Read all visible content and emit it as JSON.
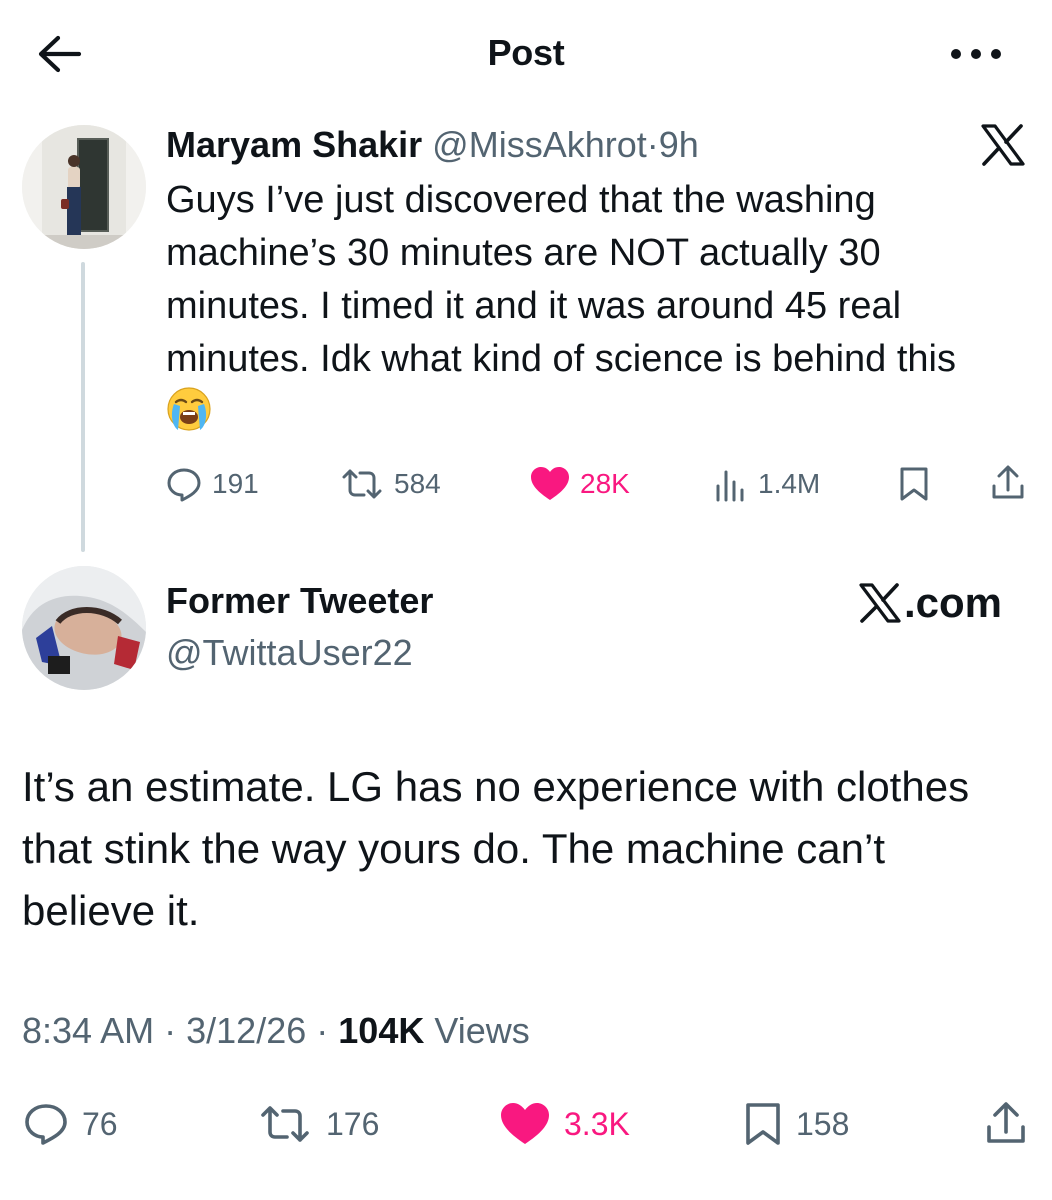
{
  "header": {
    "title": "Post"
  },
  "original_tweet": {
    "author_name": "Maryam Shakir",
    "handle": "@MissAkhrot",
    "separator": "·",
    "time": "9h",
    "text": "Guys I’ve just discovered that the washing machine’s 30 minutes are NOT actually 30 minutes. I timed it and it was around 45 real minutes. Idk what kind of science is behind this",
    "emoji": "loudly-crying-face",
    "replies": "191",
    "reposts": "584",
    "likes": "28K",
    "views": "1.4M",
    "liked": true,
    "source_logo": "x-logo-icon"
  },
  "reply_tweet": {
    "author_name": "Former Tweeter",
    "handle": "@TwittaUser22",
    "brand_text": ".com",
    "text": "It’s an estimate. LG has no experience with clothes that stink the way yours do. The machine can’t believe it.",
    "time": "8:34 AM",
    "separator": "·",
    "date": "3/12/26",
    "views_count": "104K",
    "views_label": "Views",
    "replies": "76",
    "reposts": "176",
    "likes": "3.3K",
    "bookmarks": "158",
    "liked": true
  },
  "colors": {
    "text_primary": "#0f1419",
    "text_secondary": "#536471",
    "like_pink": "#f91880",
    "thread_line": "#cfd9de"
  }
}
